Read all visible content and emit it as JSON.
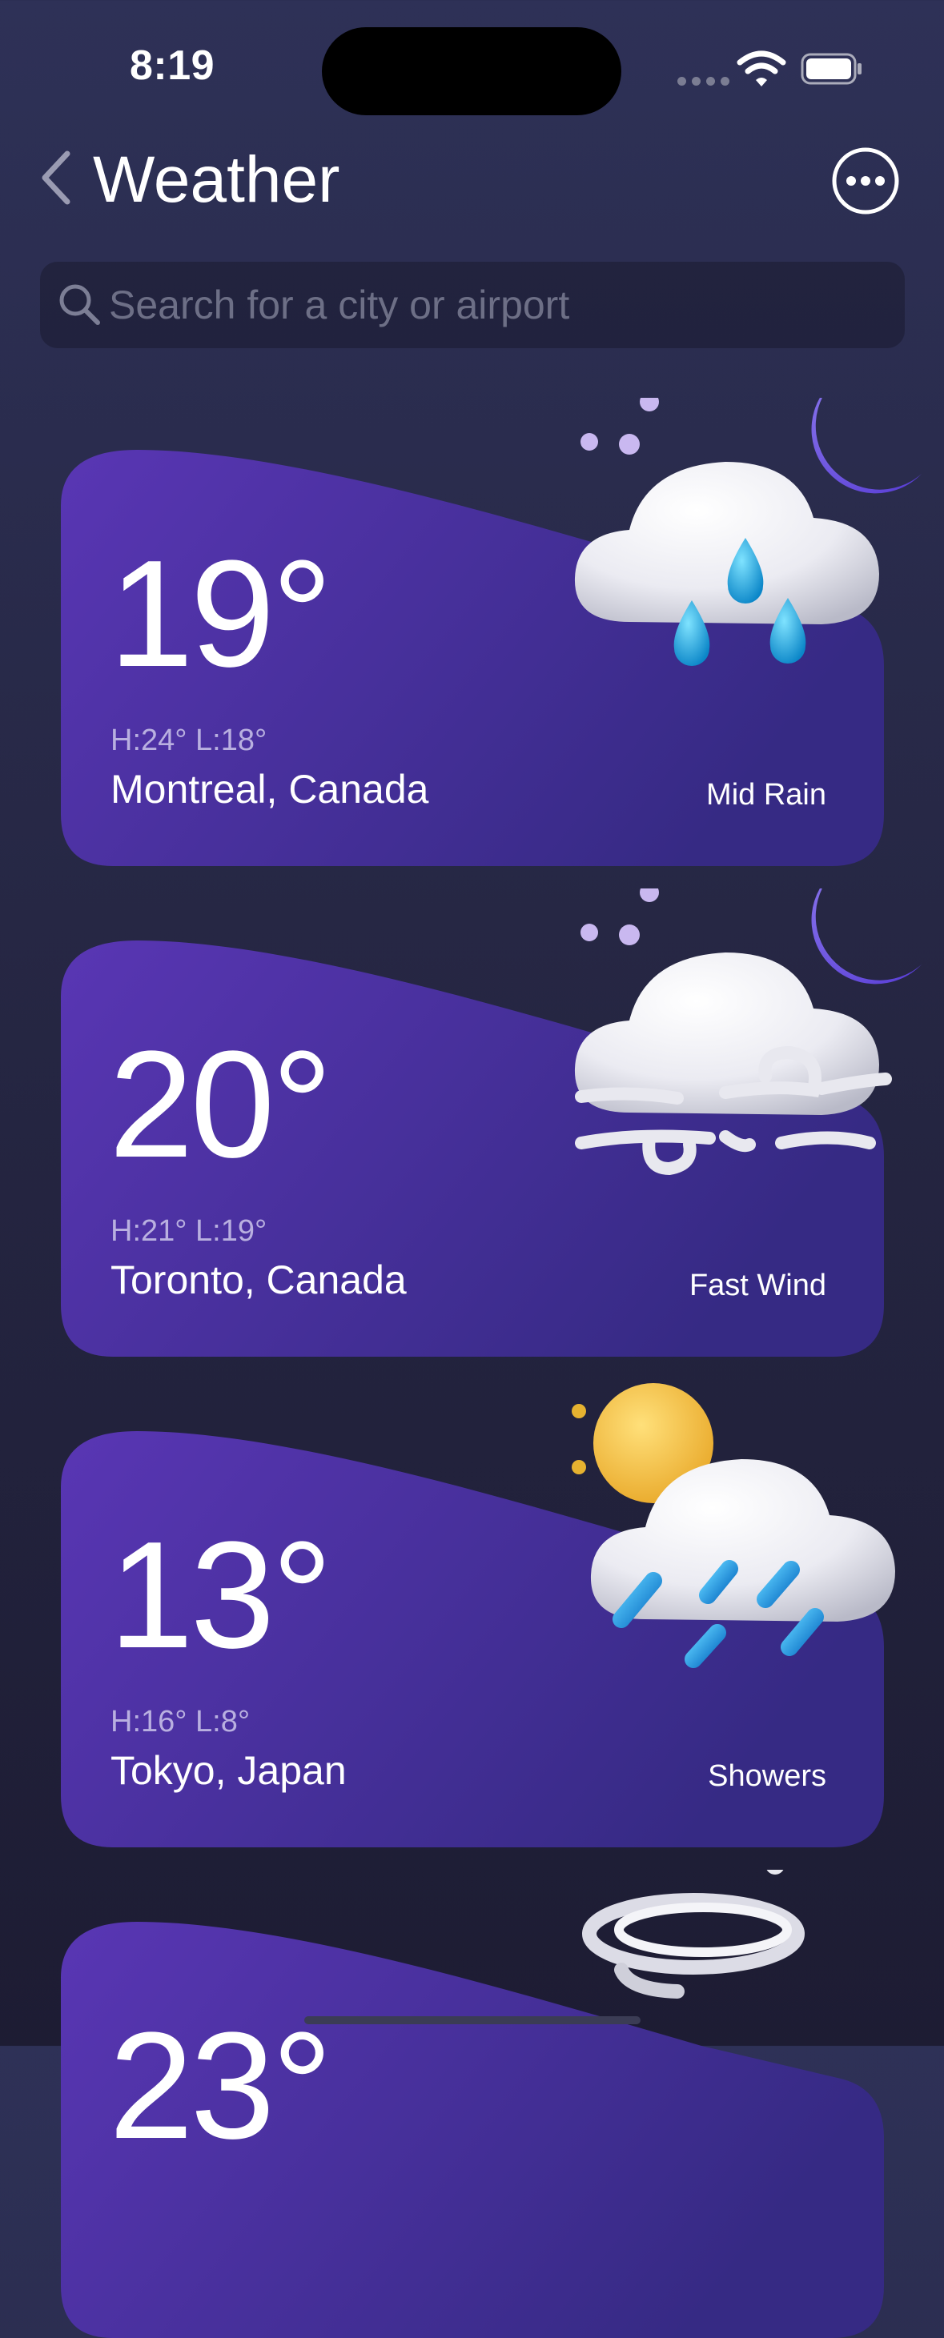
{
  "status_bar": {
    "time": "8:19"
  },
  "header": {
    "title": "Weather"
  },
  "search": {
    "placeholder": "Search for a city or airport",
    "value": ""
  },
  "cities": [
    {
      "temp": "19°",
      "hilo": "H:24° L:18°",
      "city": "Montreal, Canada",
      "condition": "Mid Rain",
      "icon": "moon-cloud-rain-icon"
    },
    {
      "temp": "20°",
      "hilo": "H:21° L:19°",
      "city": "Toronto, Canada",
      "condition": "Fast Wind",
      "icon": "moon-cloud-wind-icon"
    },
    {
      "temp": "13°",
      "hilo": "H:16° L:8°",
      "city": "Tokyo, Japan",
      "condition": "Showers",
      "icon": "sun-cloud-showers-icon"
    },
    {
      "temp": "23°",
      "hilo": "",
      "city": "",
      "condition": "",
      "icon": "tornado-icon"
    }
  ],
  "colors": {
    "background_top": "#2e3157",
    "background_bottom": "#1d1c33",
    "card_left": "#5936b4",
    "card_right": "#362a84",
    "secondary_text": "#b9b0e0"
  }
}
